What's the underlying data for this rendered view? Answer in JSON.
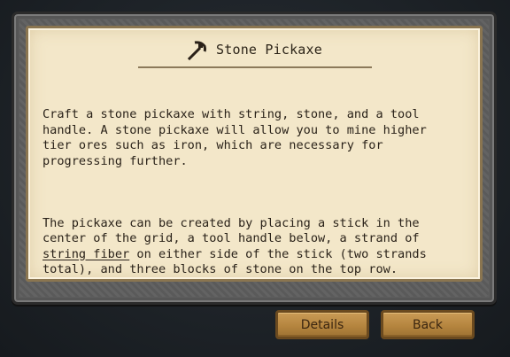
{
  "dialog": {
    "title": "Stone Pickaxe",
    "paragraph1": {
      "lines": [
        "Craft a stone pickaxe with string, stone, and a tool",
        "handle. A stone pickaxe will allow you to mine higher",
        "tier ores such as iron, which are necessary for",
        "progressing further."
      ]
    },
    "paragraph2": {
      "lines": [
        "The pickaxe can be created by placing a stick in the",
        "center of the grid, a tool handle below, a strand of"
      ],
      "link_text": "string fiber",
      "line7_after_link": " on either side of the stick (two strands",
      "line8": "total), and three blocks of stone on the top row."
    }
  },
  "buttons": {
    "details_label": "Details",
    "back_label": "Back"
  },
  "icons": {
    "title_icon": "pickaxe-icon"
  }
}
